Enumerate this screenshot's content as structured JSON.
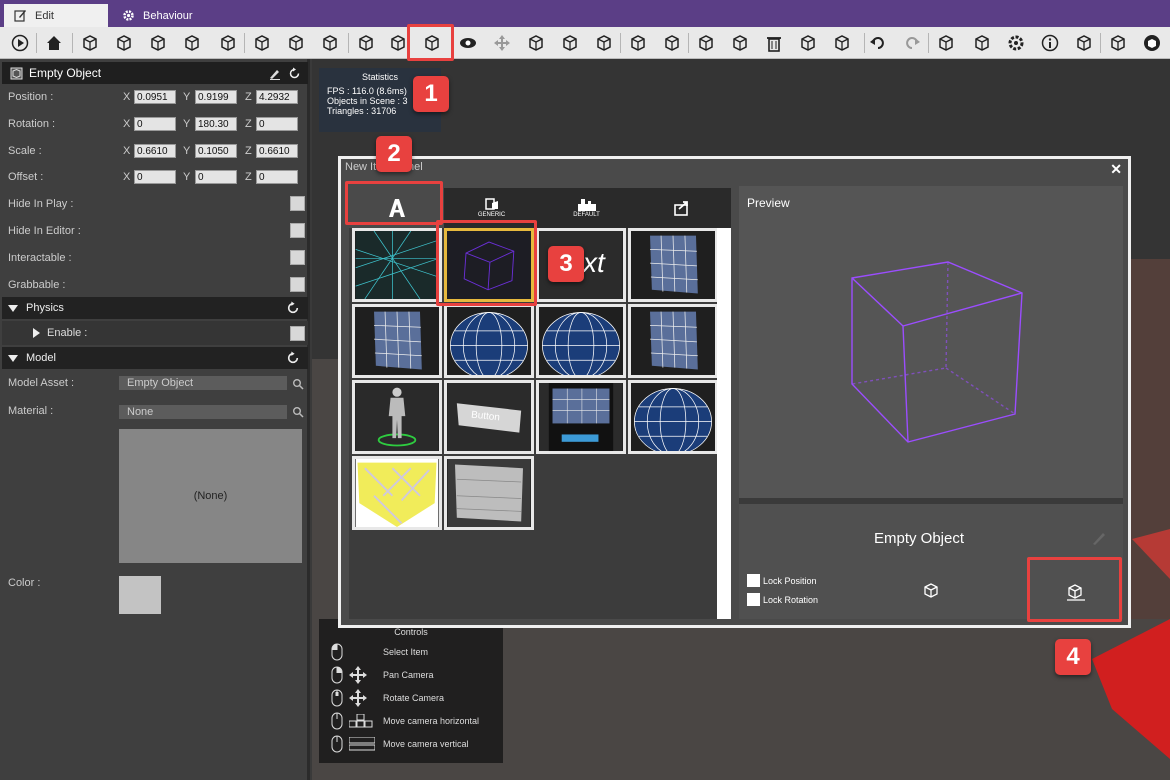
{
  "tabs": [
    {
      "label": "Edit",
      "icon": "edit-icon",
      "active": true
    },
    {
      "label": "Behaviour",
      "icon": "gear-icon",
      "active": false
    }
  ],
  "toolbar": {
    "buttons": [
      "play-icon",
      "home-icon",
      "new-scene-icon",
      "open-icon",
      "save-icon",
      "save-as-icon",
      "export-icon",
      "cube-solid-icon",
      "import-icon",
      "upload-icon",
      "script-icon",
      "new-item-icon",
      "add-item-icon",
      "eye-icon",
      "move-icon",
      "rotate-icon",
      "scale-icon",
      "transform-icon",
      "cube-outline-icon",
      "wrench-icon",
      "copy-icon",
      "paste-icon",
      "delete-icon",
      "link-icon",
      "unlink-icon",
      "undo-icon",
      "redo-icon",
      "connections-icon",
      "hand-icon",
      "settings-icon",
      "info-icon",
      "pages-icon",
      "avatar-icon",
      "logo-icon"
    ]
  },
  "inspector": {
    "title": "Empty Object",
    "position": {
      "label": "Position :",
      "x": "0.0951",
      "y": "0.9199",
      "z": "4.2932"
    },
    "rotation": {
      "label": "Rotation :",
      "x": "0",
      "y": "180.30",
      "z": "0"
    },
    "scale": {
      "label": "Scale :",
      "x": "0.6610",
      "y": "0.1050",
      "z": "0.6610"
    },
    "offset": {
      "label": "Offset :",
      "x": "0",
      "y": "0",
      "z": "0"
    },
    "axis_x": "X",
    "axis_y": "Y",
    "axis_z": "Z",
    "hide_in_play": "Hide In Play :",
    "hide_in_editor": "Hide In Editor :",
    "interactable": "Interactable :",
    "grabbable": "Grabbable :",
    "physics": {
      "title": "Physics",
      "enable": "Enable :"
    },
    "model": {
      "title": "Model",
      "asset_label": "Model Asset :",
      "asset_value": "Empty Object",
      "material_label": "Material :",
      "material_value": "None",
      "material_preview": "(None)",
      "color_label": "Color :"
    }
  },
  "stats": {
    "title": "Statistics",
    "fps": "FPS : 116.0 (8.6ms)",
    "objects": "Objects in Scene : 3",
    "triangles": "Triangles : 31706"
  },
  "controls": {
    "title": "Controls",
    "items": [
      "Select Item",
      "Pan Camera",
      "Rotate Camera",
      "Move camera horizontal",
      "Move camera vertical"
    ]
  },
  "panel": {
    "title": "New Item Panel",
    "close": "✕",
    "tabs": [
      {
        "label": "",
        "icon": "text-a-icon"
      },
      {
        "label": "GENERIC",
        "icon": "generic-icon"
      },
      {
        "label": "DEFAULT",
        "icon": "default-icon"
      },
      {
        "label": "",
        "icon": "import-icon"
      }
    ],
    "thumb_text": "xt",
    "button_text": "Button",
    "preview_label": "Preview",
    "object_name": "Empty Object",
    "lock_position": "Lock Position",
    "lock_rotation": "Lock Rotation"
  },
  "badges": [
    "1",
    "2",
    "3",
    "4"
  ],
  "colors": {
    "accent": "#5b3e86",
    "highlight": "#e8413f",
    "selected": "#e7b93e",
    "wire": "#9b4dff"
  }
}
